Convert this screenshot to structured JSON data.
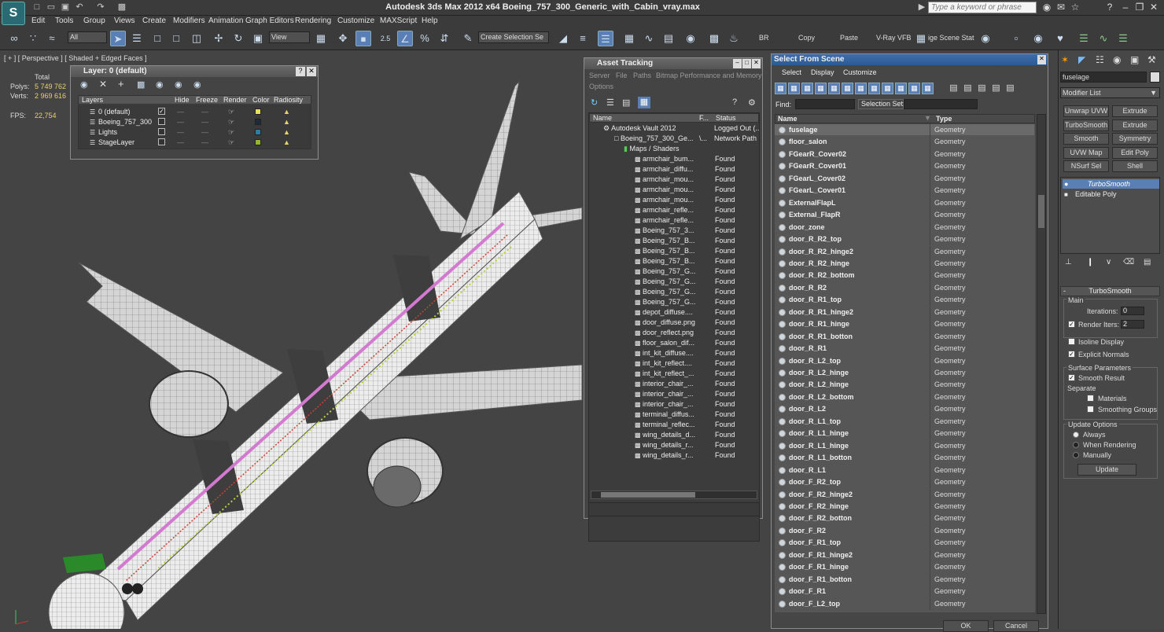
{
  "app": {
    "title": "Autodesk 3ds Max  2012 x64     Boeing_757_300_Generic_with_Cabin_vray.max",
    "search_placeholder": "Type a keyword or phrase",
    "icon_letter": "S"
  },
  "menu": [
    "Edit",
    "Tools",
    "Group",
    "Views",
    "Create",
    "Modifiers",
    "Animation",
    "Graph Editors",
    "Rendering",
    "Customize",
    "MAXScript",
    "Help"
  ],
  "toolbar": {
    "filter_select": "All",
    "refcoord_select": "View",
    "snap_value": "2.5",
    "selection_set": "Create Selection Se",
    "br": "BR",
    "copy": "Copy",
    "paste": "Paste",
    "vray_vfb": "V-Ray VFB",
    "scene_states": "ige Scene Stat"
  },
  "viewport": {
    "label": "[ + ] [ Perspective ] [ Shaded + Edged Faces ]",
    "stats": {
      "total_label": "Total",
      "polys_label": "Polys:",
      "polys": "5 749 762",
      "verts_label": "Verts:",
      "verts": "2 969 616",
      "fps_label": "FPS:",
      "fps": "22,754"
    }
  },
  "layer_panel": {
    "title": "Layer: 0 (default)",
    "columns": [
      "Layers",
      "Hide",
      "Freeze",
      "Render",
      "Color",
      "Radiosity"
    ],
    "rows": [
      {
        "name": "0 (default)",
        "checked": true,
        "color": "#e8e25a"
      },
      {
        "name": "Boeing_757_300",
        "checked": false,
        "color": "#1f2a3a"
      },
      {
        "name": "Lights",
        "checked": false,
        "color": "#2a7fa3"
      },
      {
        "name": "StageLayer",
        "checked": false,
        "color": "#96b42d"
      }
    ]
  },
  "asset_panel": {
    "title": "Asset Tracking",
    "menu": [
      "Server",
      "File",
      "Paths",
      "Bitmap Performance and Memory",
      "Options"
    ],
    "columns": [
      "Name",
      "F...",
      "Status"
    ],
    "root": {
      "name": "Autodesk Vault 2012",
      "status": "Logged Out (..."
    },
    "file": {
      "name": "Boeing_757_300_Ge...",
      "flag": "\\...",
      "status": "Network Path"
    },
    "folder": "Maps / Shaders",
    "maps": [
      "armchair_bum...",
      "armchair_diffu...",
      "armchair_mou...",
      "armchair_mou...",
      "armchair_mou...",
      "armchair_refle...",
      "armchair_refle...",
      "Boeing_757_3...",
      "Boeing_757_B...",
      "Boeing_757_B...",
      "Boeing_757_B...",
      "Boeing_757_G...",
      "Boeing_757_G...",
      "Boeing_757_G...",
      "Boeing_757_G...",
      "depot_diffuse....",
      "door_diffuse.png",
      "door_reflect.png",
      "floor_salon_dif...",
      "int_kit_diffuse....",
      "int_kit_reflect....",
      "int_kit_reflect_...",
      "interior_chair_...",
      "interior_chair_...",
      "interior_chair_...",
      "terminal_diffus...",
      "terminal_reflec...",
      "wing_details_d...",
      "wing_details_r...",
      "wing_details_r..."
    ],
    "found_label": "Found"
  },
  "select_panel": {
    "title": "Select From Scene",
    "menu": [
      "Select",
      "Display",
      "Customize"
    ],
    "find_label": "Find:",
    "selset_label": "Selection Set:",
    "columns": [
      "Name",
      "Type"
    ],
    "type_label": "Geometry",
    "objects": [
      "fuselage",
      "floor_salon",
      "FGearR_Cover02",
      "FGearR_Cover01",
      "FGearL_Cover02",
      "FGearL_Cover01",
      "ExternalFlapL",
      "External_FlapR",
      "door_zone",
      "door_R_R2_top",
      "door_R_R2_hinge2",
      "door_R_R2_hinge",
      "door_R_R2_bottom",
      "door_R_R2",
      "door_R_R1_top",
      "door_R_R1_hinge2",
      "door_R_R1_hinge",
      "door_R_R1_botton",
      "door_R_R1",
      "door_R_L2_top",
      "door_R_L2_hinge",
      "door_R_L2_hinge",
      "door_R_L2_bottom",
      "door_R_L2",
      "door_R_L1_top",
      "door_R_L1_hinge",
      "door_R_L1_hinge",
      "door_R_L1_botton",
      "door_R_L1",
      "door_F_R2_top",
      "door_F_R2_hinge2",
      "door_F_R2_hinge",
      "door_F_R2_botton",
      "door_F_R2",
      "door_F_R1_top",
      "door_F_R1_hinge2",
      "door_F_R1_hinge",
      "door_F_R1_botton",
      "door_F_R1",
      "door_F_L2_top"
    ],
    "ok": "OK",
    "cancel": "Cancel"
  },
  "command_panel": {
    "object_name": "fuselage",
    "modifier_list": "Modifier List",
    "buttons": [
      "Unwrap UVW",
      "Extrude",
      "TurboSmooth",
      "Extrude",
      "Smooth",
      "Symmetry",
      "UVW Map",
      "Edit Poly",
      "NSurf Sel",
      "Shell"
    ],
    "stack": [
      {
        "name": "TurboSmooth",
        "active": true
      },
      {
        "name": "Editable Poly",
        "active": false
      }
    ],
    "rollout_title": "TurboSmooth",
    "main_label": "Main",
    "iterations_label": "Iterations:",
    "iterations": "0",
    "render_iters_label": "Render Iters:",
    "render_iters": "2",
    "isoline": "Isoline Display",
    "explicit_normals": "Explicit Normals",
    "surface_params": "Surface Parameters",
    "smooth_result": "Smooth Result",
    "separate": "Separate",
    "materials": "Materials",
    "smoothing_groups": "Smoothing Groups",
    "update_options": "Update Options",
    "always": "Always",
    "when_rendering": "When Rendering",
    "manually": "Manually",
    "update": "Update"
  }
}
